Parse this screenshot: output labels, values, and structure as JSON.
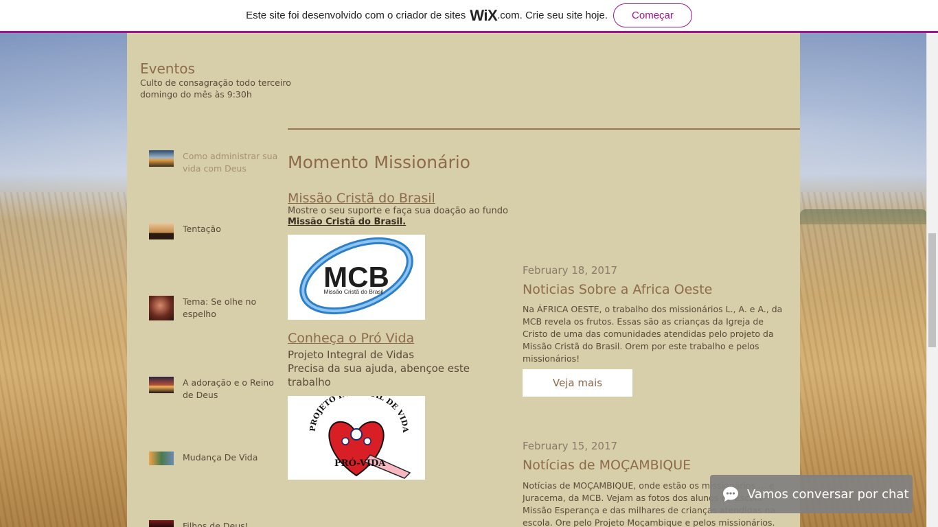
{
  "wix_banner": {
    "text_before": "Este site foi desenvolvido com o criador de sites",
    "logo": "WiX",
    "text_after": ".com. Crie seu site hoje.",
    "button_label": "Começar"
  },
  "events": {
    "title": "Eventos",
    "description": "Culto de consagração todo terceiro domingo do mês às 9:30h"
  },
  "sidebar": {
    "posts": [
      {
        "title": "Como administrar sua vida com Deus",
        "thumb_icon": "sunset-image"
      },
      {
        "title": "Tentação",
        "thumb_icon": "praying-silhouette-image"
      },
      {
        "title": "Tema: Se olhe no espelho",
        "thumb_icon": "woman-image"
      },
      {
        "title": "A adoração e o Reino de Deus",
        "thumb_icon": "worship-silhouette-image"
      },
      {
        "title": "Mudança De Vida",
        "thumb_icon": "landscape-image"
      },
      {
        "title": "Filhos de Deus!",
        "thumb_icon": "book-image"
      }
    ]
  },
  "momento": {
    "title": "Momento Missionário",
    "mcb_link": "Missão Cristã do Brasil",
    "mcb_desc": "Mostre o seu suporte e faça sua doação ao fundo",
    "mcb_bold_link": "Missão Cristã do Brasil.",
    "mcb_logo_text": "MCB",
    "mcb_logo_subtext": "Missão Cristã do Brasil",
    "provida_link": "Conheça o Pró Vida",
    "provida_line1": "Projeto Integral de Vidas",
    "provida_line2": "Precisa da sua ajuda, abençoe este trabalho",
    "provida_logo_arc": "PROJETO INTEGRAL DE VIDA",
    "provida_logo_text": "PRÓ-VIDA"
  },
  "news": [
    {
      "date": "February 18, 2017",
      "title": "Noticias Sobre a Africa Oeste",
      "body": "Na ÁFRICA OESTE, o trabalho dos missionários L., A. e A., da MCB revela os frutos. Essas são as crianças da Igreja de Cristo de uma das comunidades atendidas pelo projeto da Missão Cristã do Brasil. Orem por este trabalho e pelos missionários!"
    },
    {
      "date": "February 15, 2017",
      "title": "Notícias de MOÇAMBIQUE",
      "body": "Notícias de MOÇAMBIQUE, onde estão os missionários ... e Juracema, da MCB. Vejam as fotos dos alunos da Escola Missão Esperança e das milhares de crianças atendidas na escola. Ore pelo Projeto Moçambique e pelos missionários."
    }
  ],
  "veja_mais_label": "Veja mais",
  "chat": {
    "label": "Vamos conversar por chat",
    "icon": "chat-bubble-icon"
  },
  "colors": {
    "wix_accent": "#a0138e",
    "strip_bg": "#d6cfaa",
    "title_brown": "#8e6a4a"
  }
}
